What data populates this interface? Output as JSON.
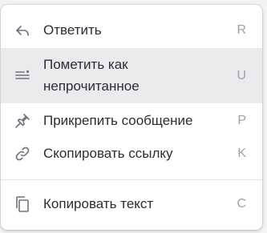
{
  "context_menu": {
    "items": [
      {
        "label": "Ответить",
        "shortcut": "R",
        "icon": "reply-icon"
      },
      {
        "label": "Пометить как непрочитанное",
        "label_line1": "Пометить как",
        "label_line2": "непрочитанное",
        "shortcut": "U",
        "icon": "mark-unread-icon",
        "hovered": true
      },
      {
        "label": "Прикрепить сообщение",
        "shortcut": "P",
        "icon": "pin-icon"
      },
      {
        "label": "Скопировать ссылку",
        "shortcut": "K",
        "icon": "link-icon"
      },
      {
        "label": "Копировать текст",
        "shortcut": "C",
        "icon": "copy-icon"
      }
    ]
  },
  "colors": {
    "hover_background": "#ebebed",
    "text": "#2b2d33",
    "shortcut_text": "#9ea1a8",
    "icon": "#6f727a"
  }
}
